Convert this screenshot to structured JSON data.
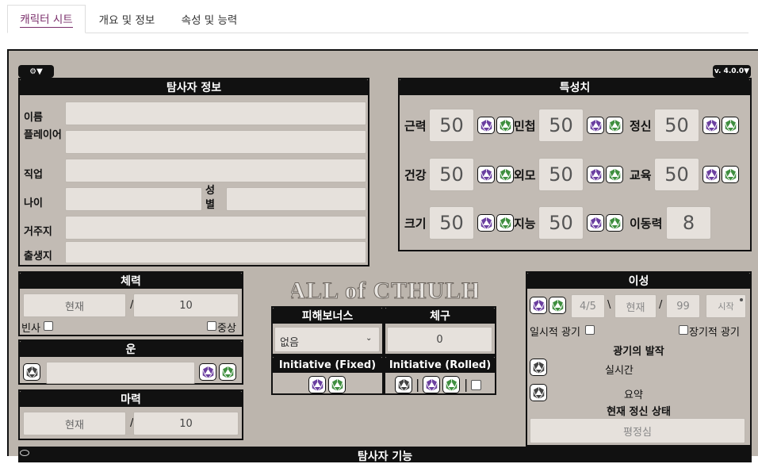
{
  "tabs": [
    {
      "label": "캐릭터 시트"
    },
    {
      "label": "개요 및 정보"
    },
    {
      "label": "속성 및 능력"
    }
  ],
  "controls": {
    "settings_label": "⚙▼",
    "version_label": "v. 4.0.0▼"
  },
  "investigator": {
    "title": "탐사자 정보",
    "fields": {
      "name": "이름",
      "player": "플레이어",
      "occupation": "직업",
      "age": "나이",
      "sex": "성별",
      "residence": "거주지",
      "birthplace": "출생지"
    }
  },
  "characteristics": {
    "title": "특성치",
    "rows": [
      [
        {
          "label": "근력",
          "value": "50"
        },
        {
          "label": "민첩",
          "value": "50"
        },
        {
          "label": "정신",
          "value": "50"
        }
      ],
      [
        {
          "label": "건강",
          "value": "50"
        },
        {
          "label": "외모",
          "value": "50"
        },
        {
          "label": "교육",
          "value": "50"
        }
      ],
      [
        {
          "label": "크기",
          "value": "50"
        },
        {
          "label": "지능",
          "value": "50"
        },
        {
          "label": "이동력",
          "value": "8"
        }
      ]
    ]
  },
  "hp": {
    "title": "체력",
    "current_placeholder": "현재",
    "slash": "/",
    "max": "10",
    "dying": "빈사",
    "major_wound": "중상"
  },
  "luck": {
    "title": "운"
  },
  "mp": {
    "title": "마력",
    "current_placeholder": "현재",
    "slash": "/",
    "max": "10"
  },
  "logo": {
    "text": "CALL of CTHULHU"
  },
  "damage_bonus": {
    "title": "피해보너스",
    "value": "없음"
  },
  "build": {
    "title": "체구",
    "value": "0"
  },
  "initiative_fixed": {
    "title": "Initiative (Fixed)"
  },
  "initiative_rolled": {
    "title": "Initiative (Rolled)",
    "sep": "|"
  },
  "sanity": {
    "title": "이성",
    "value_a": "4/5",
    "backslash": "\\",
    "current_placeholder": "현재",
    "slash": "/",
    "max": "99",
    "start_label": "시작",
    "temp_insanity": "일시적 광기",
    "indef_insanity": "장기적 광기",
    "bout_title": "광기의 발작",
    "realtime": "실시간",
    "summary": "요약",
    "mental_state_title": "현재 정신 상태",
    "mental_state_value": "평정심"
  },
  "skills": {
    "title": "탐사자 기능"
  },
  "colors": {
    "purple_die": "#6b3fa0",
    "green_die": "#3f8f3f",
    "header": "#111111",
    "panel": "#bcb5ad"
  }
}
